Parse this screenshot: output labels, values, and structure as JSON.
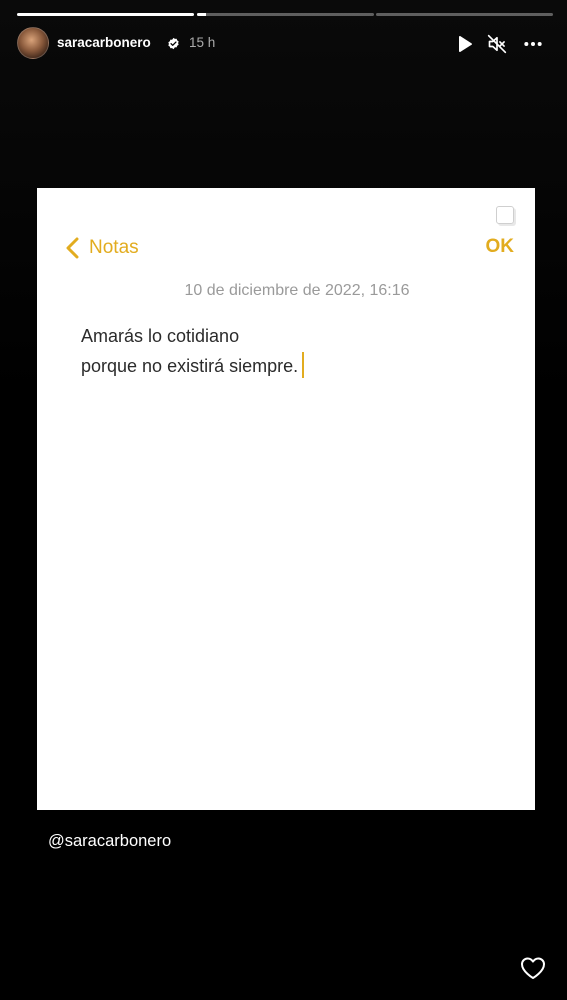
{
  "story": {
    "segments": [
      {
        "fill": 1.0
      },
      {
        "fill": 0.05
      },
      {
        "fill": 0.0
      }
    ]
  },
  "header": {
    "username": "saracarbonero",
    "time": "15 h",
    "icons": [
      "play-icon",
      "mute-icon",
      "more-icon"
    ]
  },
  "note": {
    "back_label": "Notas",
    "done_label": "OK",
    "date": "10 de diciembre de 2022, 16:16",
    "lines": [
      "Amarás lo cotidiano",
      "porque no existirá siempre."
    ]
  },
  "mention": "@saracarbonero",
  "colors": {
    "notes_accent": "#e2ac1f",
    "background": "#000000"
  }
}
